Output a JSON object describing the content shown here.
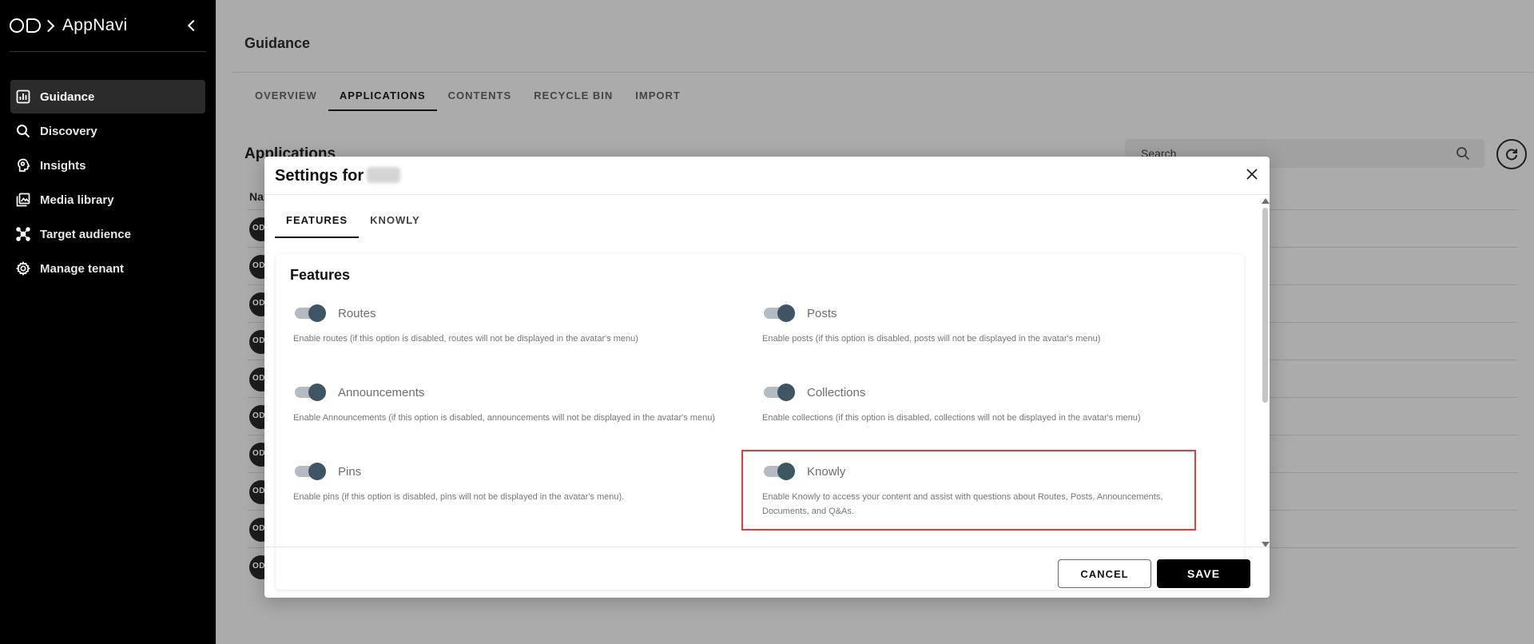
{
  "app": {
    "name": "AppNavi"
  },
  "sidebar": {
    "items": [
      {
        "label": "Guidance",
        "icon": "chart-icon",
        "active": true
      },
      {
        "label": "Discovery",
        "icon": "search-icon"
      },
      {
        "label": "Insights",
        "icon": "brain-icon"
      },
      {
        "label": "Media library",
        "icon": "image-library-icon"
      },
      {
        "label": "Target audience",
        "icon": "network-icon"
      },
      {
        "label": "Manage tenant",
        "icon": "gear-icon"
      }
    ]
  },
  "main": {
    "title": "Guidance",
    "tabs": [
      "OVERVIEW",
      "APPLICATIONS",
      "CONTENTS",
      "RECYCLE BIN",
      "IMPORT"
    ],
    "active_tab": "APPLICATIONS",
    "section_title": "Applications",
    "search": {
      "placeholder": "Search"
    },
    "name_column_partial": "Nam"
  },
  "modal": {
    "title": "Settings for",
    "tabs": [
      "FEATURES",
      "KNOWLY"
    ],
    "active_tab": "FEATURES",
    "features_title": "Features",
    "features": [
      {
        "label": "Routes",
        "enabled": true,
        "description": "Enable routes (if this option is disabled, routes will not be displayed in the avatar's menu)"
      },
      {
        "label": "Posts",
        "enabled": true,
        "description": "Enable posts (if this option is disabled, posts will not be displayed in the avatar's menu)"
      },
      {
        "label": "Announcements",
        "enabled": true,
        "description": "Enable Announcements (if this option is disabled, announcements will not be displayed in the avatar's menu)"
      },
      {
        "label": "Collections",
        "enabled": true,
        "description": "Enable collections (if this option is disabled, collections will not be displayed in the avatar's menu)"
      },
      {
        "label": "Pins",
        "enabled": true,
        "description": "Enable pins (if this option is disabled, pins will not be displayed in the avatar's menu)."
      },
      {
        "label": "Knowly",
        "enabled": true,
        "highlighted": true,
        "description": "Enable Knowly to access your content and assist with questions about Routes, Posts, Announcements, Documents, and Q&As."
      }
    ],
    "buttons": {
      "cancel": "CANCEL",
      "save": "SAVE"
    }
  },
  "colors": {
    "sidebar_bg": "#000000",
    "overlay_bg": "#ababab",
    "toggle_knob": "#3e5563",
    "toggle_track": "#b4bbc3",
    "highlight": "#e03c3c",
    "primary_button": "#000000"
  }
}
